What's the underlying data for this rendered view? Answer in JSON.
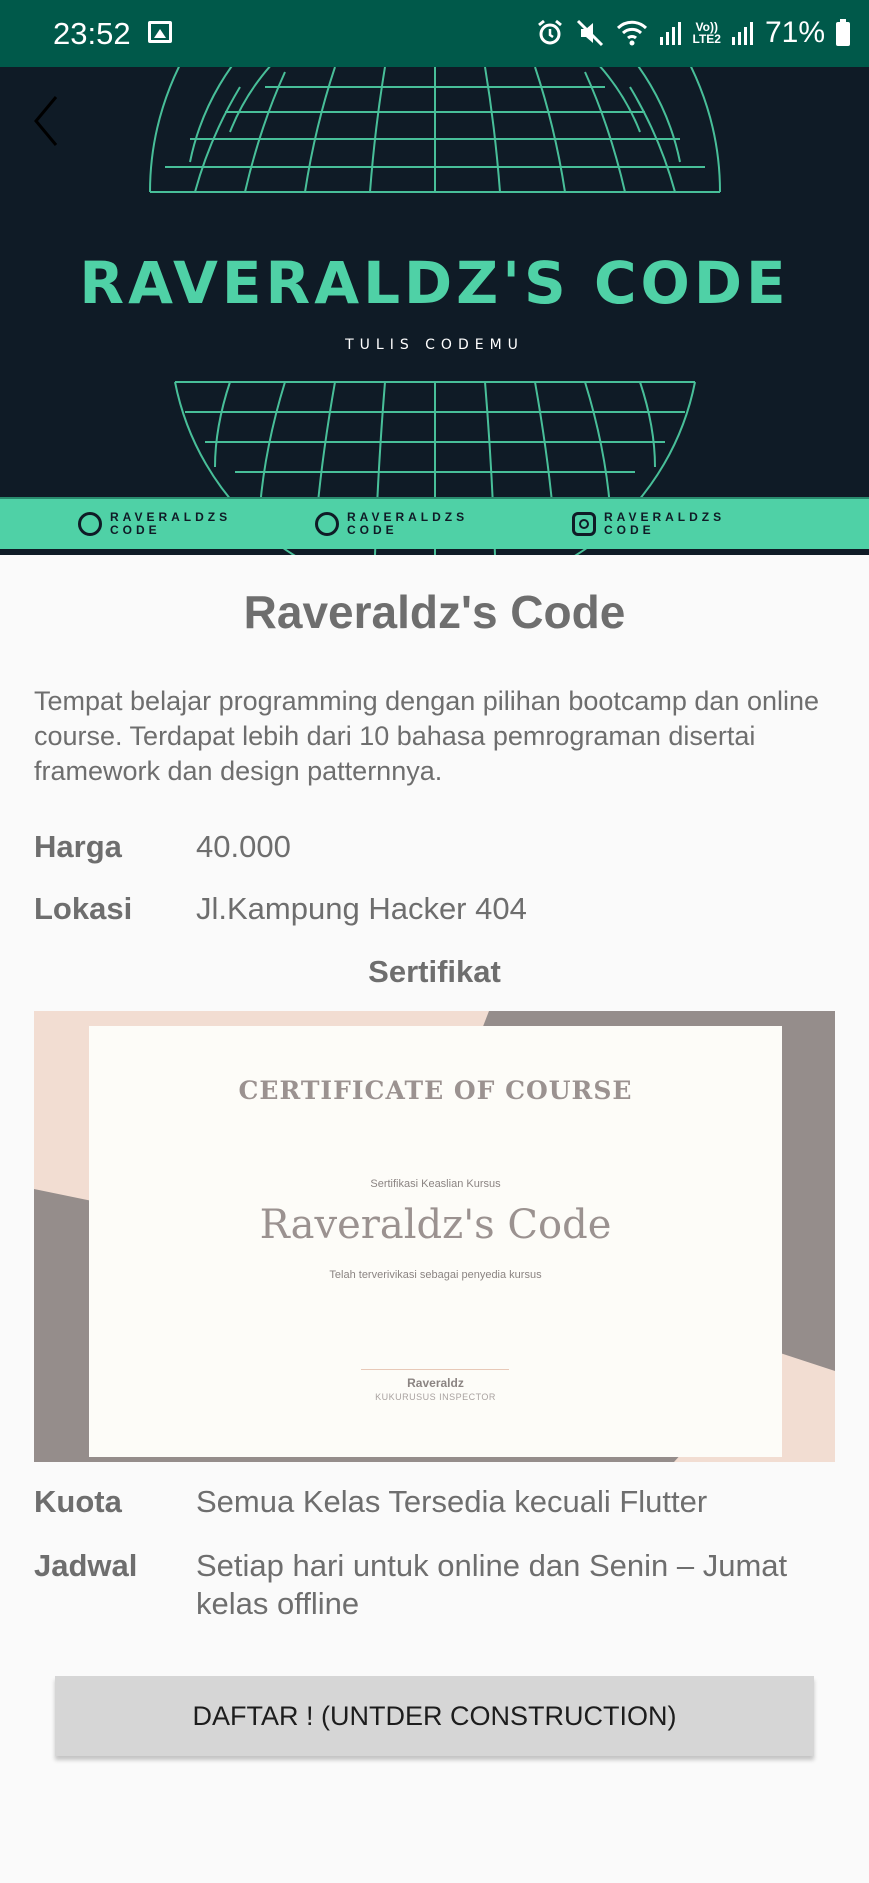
{
  "status_bar": {
    "time": "23:52",
    "battery_percent": "71%",
    "network_label_top": "Vo))",
    "network_label_bottom": "LTE2",
    "icons": [
      "gallery-icon",
      "alarm-icon",
      "mute-icon",
      "wifi-icon",
      "signal-icon",
      "battery-icon"
    ]
  },
  "banner": {
    "title": "RAVERALDZ'S CODE",
    "subtitle": "TULIS CODEMU",
    "strip_items": [
      {
        "line1": "RAVERALDZS",
        "line2": "CODE",
        "icon": "whatsapp-icon"
      },
      {
        "line1": "RAVERALDZS",
        "line2": "CODE",
        "icon": "whatsapp-icon"
      },
      {
        "line1": "RAVERALDZS",
        "line2": "CODE",
        "icon": "instagram-icon"
      }
    ],
    "colors": {
      "background": "#0f1b26",
      "accent": "#4fd1a6"
    }
  },
  "detail": {
    "title": "Raveraldz's Code",
    "description": "Tempat belajar programming dengan pilihan bootcamp dan online course. Terdapat lebih dari 10 bahasa pemrograman disertai framework dan design patternnya.",
    "harga_label": "Harga",
    "harga_value": "40.000",
    "lokasi_label": "Lokasi",
    "lokasi_value": "Jl.Kampung Hacker 404",
    "sertifikat_label": "Sertifikat",
    "kuota_label": "Kuota",
    "kuota_value": "Semua Kelas Tersedia kecuali Flutter",
    "jadwal_label": "Jadwal",
    "jadwal_value": "Setiap hari untuk online dan Senin – Jumat kelas offline"
  },
  "certificate": {
    "heading": "CERTIFICATE OF COURSE",
    "small_label": "Sertifikasi Keaslian Kursus",
    "name": "Raveraldz's Code",
    "verified": "Telah terverivikasi sebagai penyedia kursus",
    "signer": "Raveraldz",
    "signer_role": "KUKURUSUS INSPECTOR"
  },
  "button": {
    "label": "DAFTAR ! (UNTDER CONSTRUCTION)"
  }
}
